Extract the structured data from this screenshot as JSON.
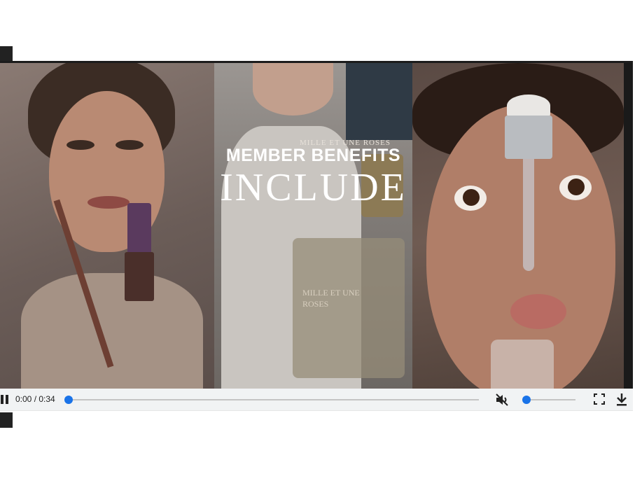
{
  "video": {
    "overlay_title_line1": "MEMBER BENEFITS",
    "overlay_title_line2": "INCLUDE",
    "brand_text": "MILLE ET UNE ROSES",
    "bottle_label_line1": "MILLE ET UNE",
    "bottle_label_line2": "ROSES"
  },
  "controls": {
    "time": "0:00 / 0:34",
    "progress": 0,
    "volume_level": 0,
    "muted": true,
    "play_state": "playing",
    "accent_color": "#1a73e8",
    "icons": [
      "pause-icon",
      "mute-icon",
      "fullscreen-icon",
      "download-icon"
    ]
  }
}
